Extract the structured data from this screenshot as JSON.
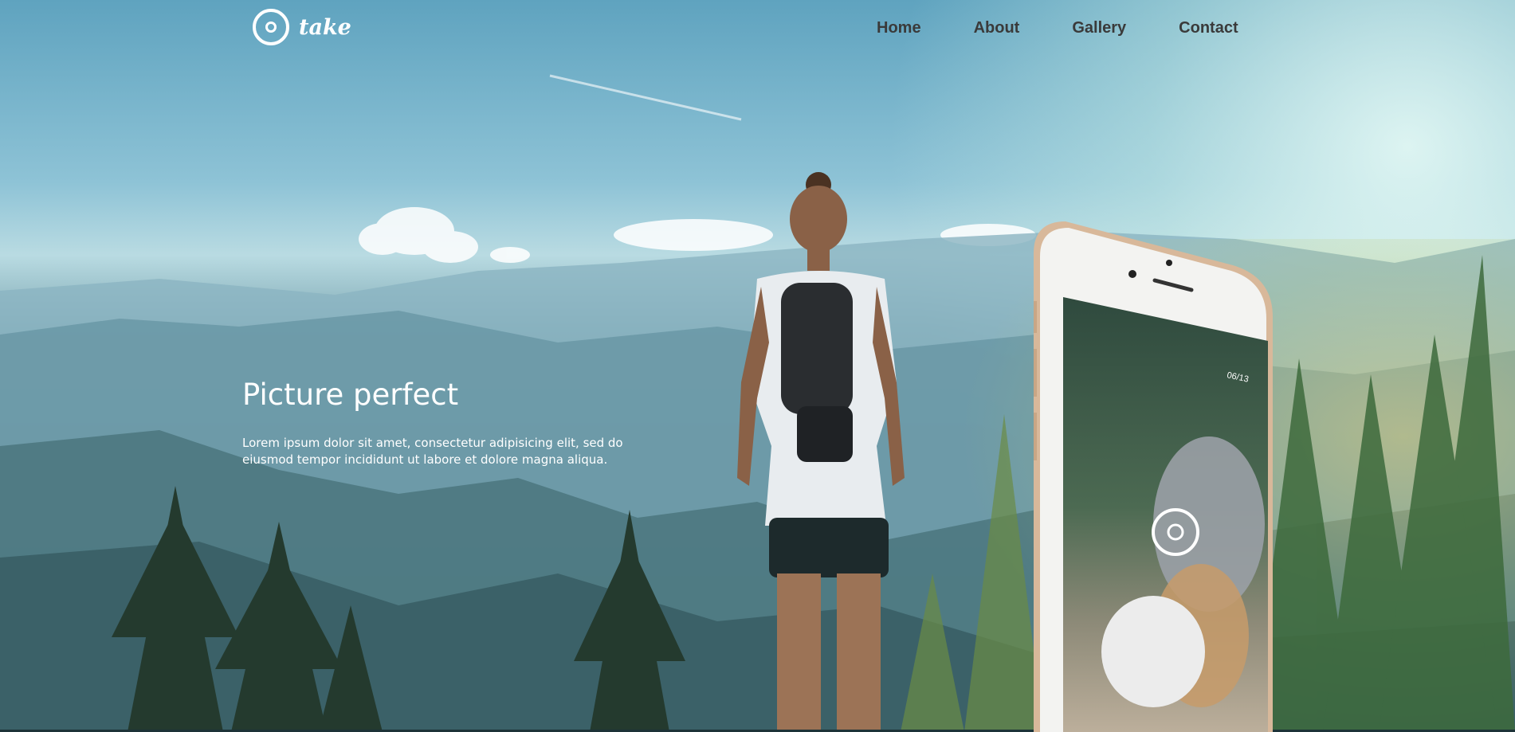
{
  "brand": {
    "name": "take",
    "icon": "ring-logo-icon"
  },
  "nav": {
    "items": [
      "Home",
      "About",
      "Gallery",
      "Contact"
    ]
  },
  "hero": {
    "title": "Picture perfect",
    "text": "Lorem ipsum dolor sit amet, consectetur adipisicing elit, sed do eiusmod tempor incididunt ut labore et dolore magna aliqua."
  },
  "phone": {
    "counter": "06/13",
    "icon": "ring-logo-icon"
  },
  "colors": {
    "nav_text": "#3a3a3a",
    "hero_text": "#ffffff",
    "phone_frame": "#d8b89a"
  }
}
